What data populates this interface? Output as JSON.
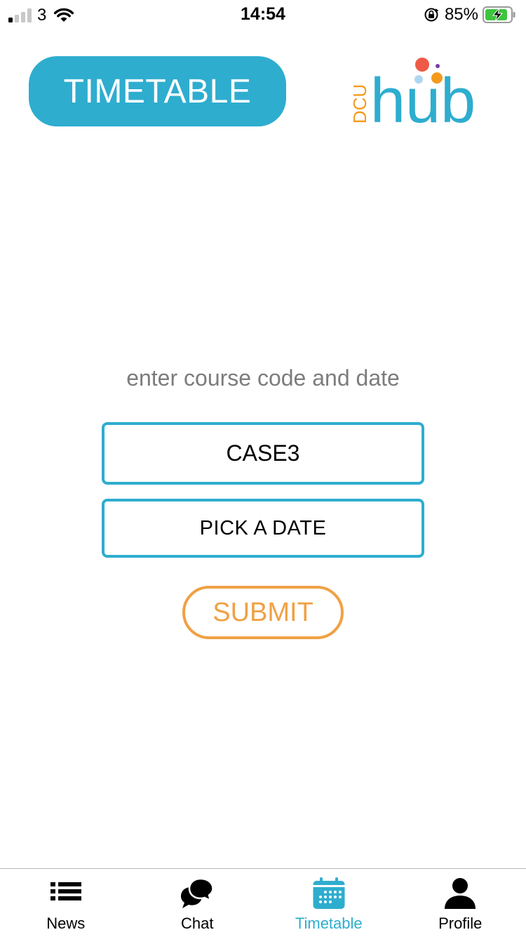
{
  "status_bar": {
    "carrier": "3",
    "time": "14:54",
    "battery": "85%",
    "signal_bars_on": 1,
    "battery_level": 0.85
  },
  "header": {
    "title": "TIMETABLE",
    "logo_small_text": "DCU",
    "logo_text": "hub"
  },
  "form": {
    "prompt": "enter course code and date",
    "course_code": "CASE3",
    "date_label": "PICK A DATE",
    "submit_label": "SUBMIT"
  },
  "tabs": [
    {
      "label": "News",
      "icon": "list-icon",
      "active": false
    },
    {
      "label": "Chat",
      "icon": "chat-icon",
      "active": false
    },
    {
      "label": "Timetable",
      "icon": "calendar-icon",
      "active": true
    },
    {
      "label": "Profile",
      "icon": "person-icon",
      "active": false
    }
  ],
  "colors": {
    "accent": "#2eadcf",
    "submit": "#f0a144",
    "prompt_text": "#7c7c7c",
    "battery_green": "#3fc43f"
  }
}
